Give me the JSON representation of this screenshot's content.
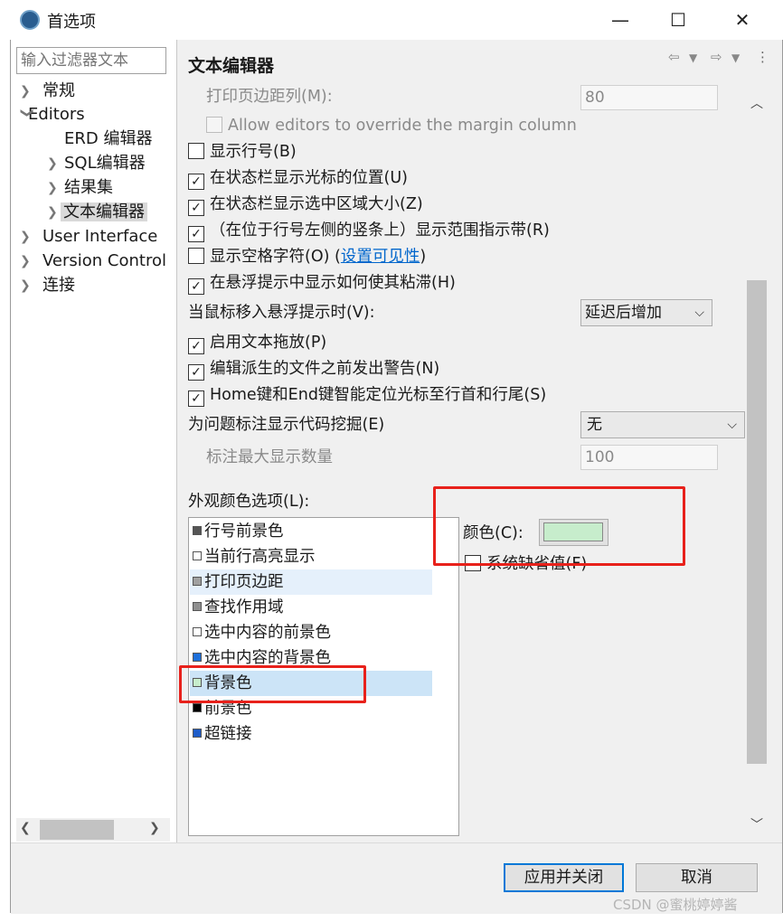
{
  "window": {
    "title": "首选项",
    "controls": {
      "minimize": "—",
      "maximize": "☐",
      "close": "✕"
    }
  },
  "filter": {
    "placeholder": "输入过滤器文本"
  },
  "tree": [
    {
      "label": "常规"
    },
    {
      "label": "Editors"
    },
    {
      "label": "ERD 编辑器"
    },
    {
      "label": "SQL编辑器"
    },
    {
      "label": "结果集"
    },
    {
      "label": "文本编辑器"
    },
    {
      "label": "User Interface"
    },
    {
      "label": "Version Control"
    },
    {
      "label": "连接"
    }
  ],
  "page": {
    "title": "文本编辑器",
    "print_margin_label": "打印页边距列(M):",
    "print_margin_value": "80",
    "allow_override": "Allow editors to override the margin column",
    "show_line_numbers": "显示行号(B)",
    "show_cursor_pos": "在状态栏显示光标的位置(U)",
    "show_selection_size": "在状态栏显示选中区域大小(Z)",
    "show_range_indicator": "（在位于行号左侧的竖条上）显示范围指示带(R)",
    "show_whitespace": "显示空格字符(O) ",
    "whitespace_link": "设置可见性",
    "whitespace_close": ")",
    "sticky_hover": "在悬浮提示中显示如何使其粘滞(H)",
    "hover_label": "当鼠标移入悬浮提示时(V):",
    "hover_value": "延迟后增加",
    "drag_drop": "启用文本拖放(P)",
    "derived_warn": "编辑派生的文件之前发出警告(N)",
    "smart_home": "Home键和End键智能定位光标至行首和行尾(S)",
    "code_mining_label": "为问题标注显示代码挖掘(E)",
    "code_mining_value": "无",
    "max_annotations_label": "标注最大显示数量",
    "max_annotations_value": "100",
    "appearance_label": "外观颜色选项(L):",
    "color_label": "颜色(C):",
    "system_default": "系统缺省值(F)"
  },
  "appearance_items": [
    {
      "label": "行号前景色",
      "color": "#555555"
    },
    {
      "label": "当前行高亮显示",
      "color": "#ffffff"
    },
    {
      "label": "打印页边距",
      "color": "#a0a0a0"
    },
    {
      "label": "查找作用域",
      "color": "#909090"
    },
    {
      "label": "选中内容的前景色",
      "color": "#ffffff"
    },
    {
      "label": "选中内容的背景色",
      "color": "#1e6fd9"
    },
    {
      "label": "背景色",
      "color": "#c7edcc"
    },
    {
      "label": "前景色",
      "color": "#000000"
    },
    {
      "label": "超链接",
      "color": "#1e5cc8"
    }
  ],
  "selected_color": "#c7edcc",
  "buttons": {
    "apply_close": "应用并关闭",
    "cancel": "取消"
  },
  "watermark": "CSDN @蜜桃婷婷酱"
}
